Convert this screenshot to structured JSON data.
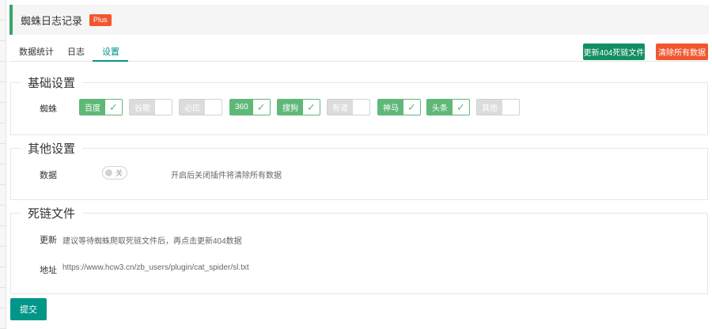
{
  "header": {
    "title": "蜘蛛日志记录",
    "badge": "Plus"
  },
  "tabs": [
    {
      "label": "数据统计",
      "active": false
    },
    {
      "label": "日志",
      "active": false
    },
    {
      "label": "设置",
      "active": true
    }
  ],
  "actions": {
    "refresh_label": "更新404死链文件",
    "clear_label": "清除所有数据"
  },
  "basic": {
    "legend": "基础设置",
    "spider_label": "蜘蛛",
    "spiders": [
      {
        "label": "百度",
        "checked": true
      },
      {
        "label": "谷歌",
        "checked": false
      },
      {
        "label": "必应",
        "checked": false
      },
      {
        "label": "360",
        "checked": true
      },
      {
        "label": "搜狗",
        "checked": true
      },
      {
        "label": "有道",
        "checked": false
      },
      {
        "label": "神马",
        "checked": true
      },
      {
        "label": "头条",
        "checked": true
      },
      {
        "label": "其他",
        "checked": false
      }
    ],
    "check_mark": "✓"
  },
  "other": {
    "legend": "其他设置",
    "data_label": "数据",
    "switch_text": "关",
    "hint": "开启后关闭插件将清除所有数据"
  },
  "deadlink": {
    "legend": "死链文件",
    "update_label": "更新",
    "update_hint": "建议等待蜘蛛爬取死链文件后，再点击更新404数据",
    "address_label": "地址",
    "address_value": "https://www.hcw3.cn/zb_users/plugin/cat_spider/sl.txt"
  },
  "submit_label": "提交",
  "colors": {
    "accent": "#009688",
    "checked": "#5fb878",
    "danger": "#f0572f",
    "header_bar": "#3aa36b"
  }
}
